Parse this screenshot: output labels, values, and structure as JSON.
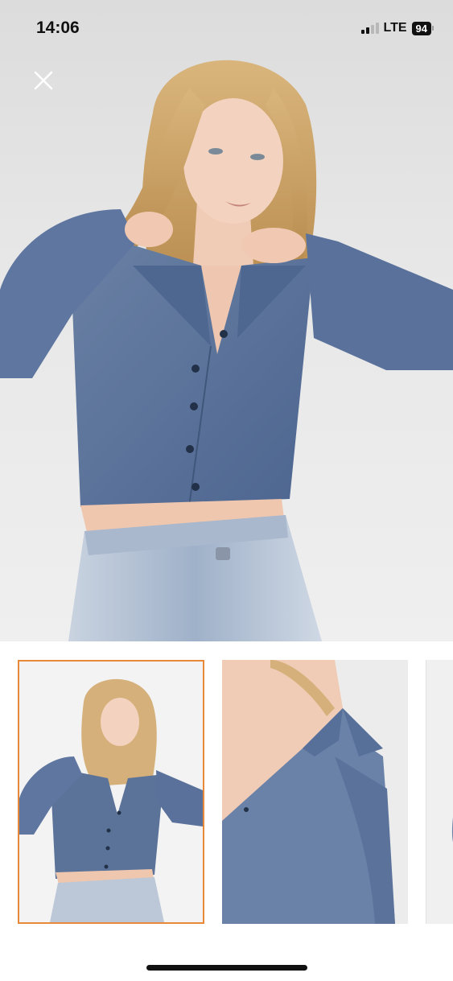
{
  "status_bar": {
    "time": "14:06",
    "network": "LTE",
    "battery": "94"
  },
  "icons": {
    "close": "close-icon",
    "signal": "signal-icon",
    "battery": "battery-icon"
  },
  "gallery": {
    "selected_index": 0,
    "thumbnails": [
      {
        "view": "front"
      },
      {
        "view": "collar-detail"
      },
      {
        "view": "partial"
      }
    ]
  },
  "colors": {
    "accent_border": "#e8893a",
    "garment": "#5a7398",
    "jeans": "#bcc8d8"
  }
}
